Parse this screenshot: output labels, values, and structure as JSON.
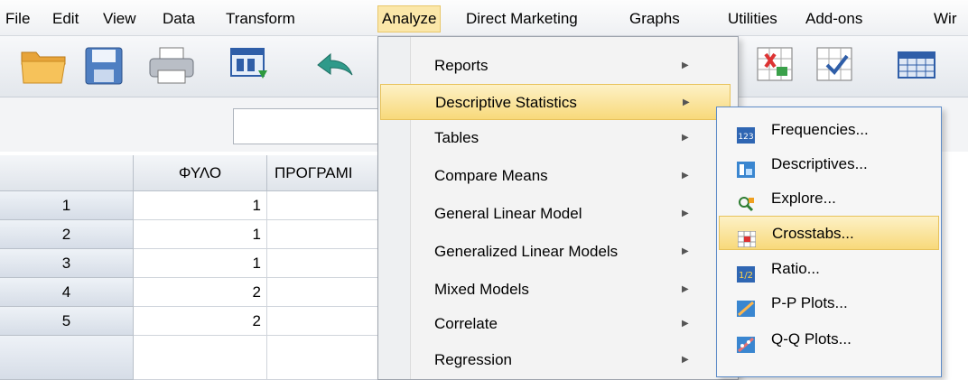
{
  "menubar": {
    "items": [
      {
        "label": "File",
        "active": false
      },
      {
        "label": "Edit",
        "active": false
      },
      {
        "label": "View",
        "active": false
      },
      {
        "label": "Data",
        "active": false
      },
      {
        "label": "Transform",
        "active": false
      },
      {
        "label": "Analyze",
        "active": true
      },
      {
        "label": "Direct Marketing",
        "active": false
      },
      {
        "label": "Graphs",
        "active": false
      },
      {
        "label": "Utilities",
        "active": false
      },
      {
        "label": "Add-ons",
        "active": false
      },
      {
        "label": "Wir",
        "active": false
      }
    ]
  },
  "toolbar": {
    "icons": [
      "open-folder-icon",
      "save-icon",
      "print-icon",
      "dialog-recall-icon",
      "undo-icon",
      "insert-cases-icon",
      "select-cases-icon",
      "value-labels-icon"
    ]
  },
  "grid": {
    "columns": [
      "ΦΥΛΟ",
      "ΠΡΟΓΡΑΜΙ"
    ],
    "rows": [
      {
        "row": "1",
        "values": [
          "1",
          ""
        ]
      },
      {
        "row": "2",
        "values": [
          "1",
          ""
        ]
      },
      {
        "row": "3",
        "values": [
          "1",
          ""
        ]
      },
      {
        "row": "4",
        "values": [
          "2",
          ""
        ]
      },
      {
        "row": "5",
        "values": [
          "2",
          ""
        ]
      }
    ]
  },
  "analyze_menu": {
    "items": [
      {
        "label": "Reports",
        "submenu": true,
        "highlighted": false
      },
      {
        "label": "Descriptive Statistics",
        "submenu": true,
        "highlighted": true
      },
      {
        "label": "Tables",
        "submenu": true,
        "highlighted": false
      },
      {
        "label": "Compare Means",
        "submenu": true,
        "highlighted": false
      },
      {
        "label": "General Linear Model",
        "submenu": true,
        "highlighted": false
      },
      {
        "label": "Generalized Linear Models",
        "submenu": true,
        "highlighted": false
      },
      {
        "label": "Mixed Models",
        "submenu": true,
        "highlighted": false
      },
      {
        "label": "Correlate",
        "submenu": true,
        "highlighted": false
      },
      {
        "label": "Regression",
        "submenu": true,
        "highlighted": false
      }
    ]
  },
  "descriptive_submenu": {
    "items": [
      {
        "label": "Frequencies...",
        "icon": "frequencies-icon",
        "highlighted": false
      },
      {
        "label": "Descriptives...",
        "icon": "descriptives-icon",
        "highlighted": false
      },
      {
        "label": "Explore...",
        "icon": "explore-icon",
        "highlighted": false
      },
      {
        "label": "Crosstabs...",
        "icon": "crosstabs-icon",
        "highlighted": true
      },
      {
        "label": "Ratio...",
        "icon": "ratio-icon",
        "highlighted": false
      },
      {
        "label": "P-P Plots...",
        "icon": "pp-plots-icon",
        "highlighted": false
      },
      {
        "label": "Q-Q Plots...",
        "icon": "qq-plots-icon",
        "highlighted": false
      }
    ]
  },
  "colors": {
    "highlight": "#f8d97a",
    "highlight_border": "#e7c25b",
    "submenu_border": "#5e8cc8",
    "row_header": "#dbe3ed"
  }
}
